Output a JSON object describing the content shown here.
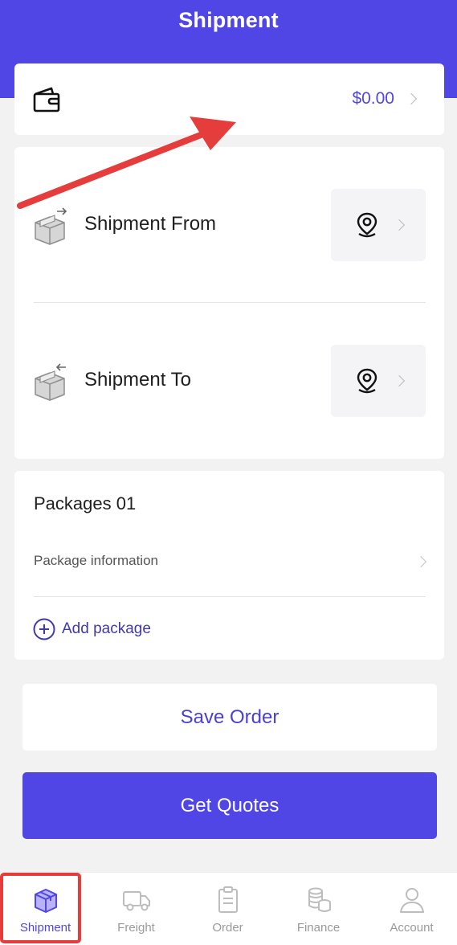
{
  "header": {
    "title": "Shipment"
  },
  "wallet": {
    "icon": "wallet-icon",
    "balance": "$0.00"
  },
  "route": {
    "from_label": "Shipment From",
    "to_label": "Shipment To",
    "location_icon": "location-pin-icon"
  },
  "packages": {
    "title": "Packages 01",
    "info_label": "Package information",
    "add_label": "Add package"
  },
  "actions": {
    "save_label": "Save Order",
    "quote_label": "Get Quotes"
  },
  "tabs": [
    {
      "label": "Shipment",
      "icon": "box-icon",
      "active": true
    },
    {
      "label": "Freight",
      "icon": "truck-icon",
      "active": false
    },
    {
      "label": "Order",
      "icon": "clipboard-icon",
      "active": false
    },
    {
      "label": "Finance",
      "icon": "coins-icon",
      "active": false
    },
    {
      "label": "Account",
      "icon": "user-icon",
      "active": false
    }
  ],
  "colors": {
    "brand": "#5046e5",
    "background": "#f2f2f2",
    "annotation": "#e53c3c"
  }
}
